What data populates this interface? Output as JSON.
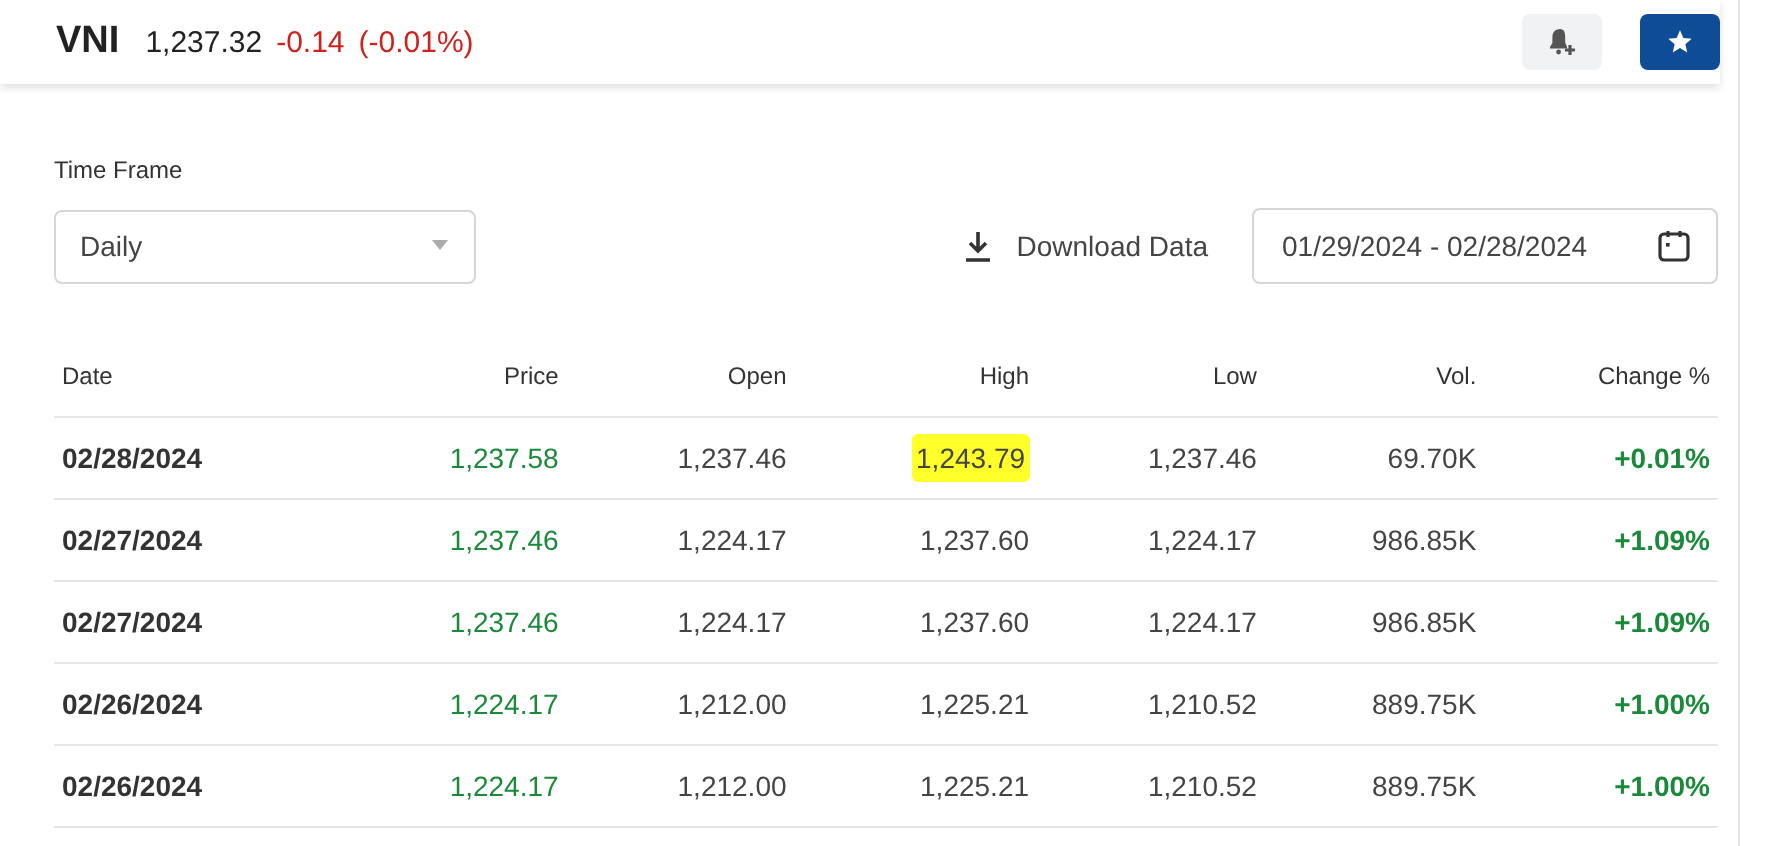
{
  "header": {
    "symbol": "VNI",
    "price": "1,237.32",
    "change": "-0.14",
    "change_pct": "(-0.01%)",
    "color": "#d0211c"
  },
  "time_frame": {
    "label": "Time Frame",
    "value": "Daily"
  },
  "download": {
    "label": "Download Data"
  },
  "date_range": {
    "value": "01/29/2024 - 02/28/2024"
  },
  "table": {
    "columns": [
      "Date",
      "Price",
      "Open",
      "High",
      "Low",
      "Vol.",
      "Change %"
    ],
    "rows": [
      {
        "date": "02/28/2024",
        "price": "1,237.58",
        "open": "1,237.46",
        "high": "1,243.79",
        "low": "1,237.46",
        "vol": "69.70K",
        "change": "+0.01%",
        "color": "#1a8a3a",
        "high_highlighted": true
      },
      {
        "date": "02/27/2024",
        "price": "1,237.46",
        "open": "1,224.17",
        "high": "1,237.60",
        "low": "1,224.17",
        "vol": "986.85K",
        "change": "+1.09%",
        "color": "#1a8a3a",
        "high_highlighted": false
      },
      {
        "date": "02/27/2024",
        "price": "1,237.46",
        "open": "1,224.17",
        "high": "1,237.60",
        "low": "1,224.17",
        "vol": "986.85K",
        "change": "+1.09%",
        "color": "#1a8a3a",
        "high_highlighted": false
      },
      {
        "date": "02/26/2024",
        "price": "1,224.17",
        "open": "1,212.00",
        "high": "1,225.21",
        "low": "1,210.52",
        "vol": "889.75K",
        "change": "+1.00%",
        "color": "#1a8a3a",
        "high_highlighted": false
      },
      {
        "date": "02/26/2024",
        "price": "1,224.17",
        "open": "1,212.00",
        "high": "1,225.21",
        "low": "1,210.52",
        "vol": "889.75K",
        "change": "+1.00%",
        "color": "#1a8a3a",
        "high_highlighted": false
      }
    ]
  }
}
